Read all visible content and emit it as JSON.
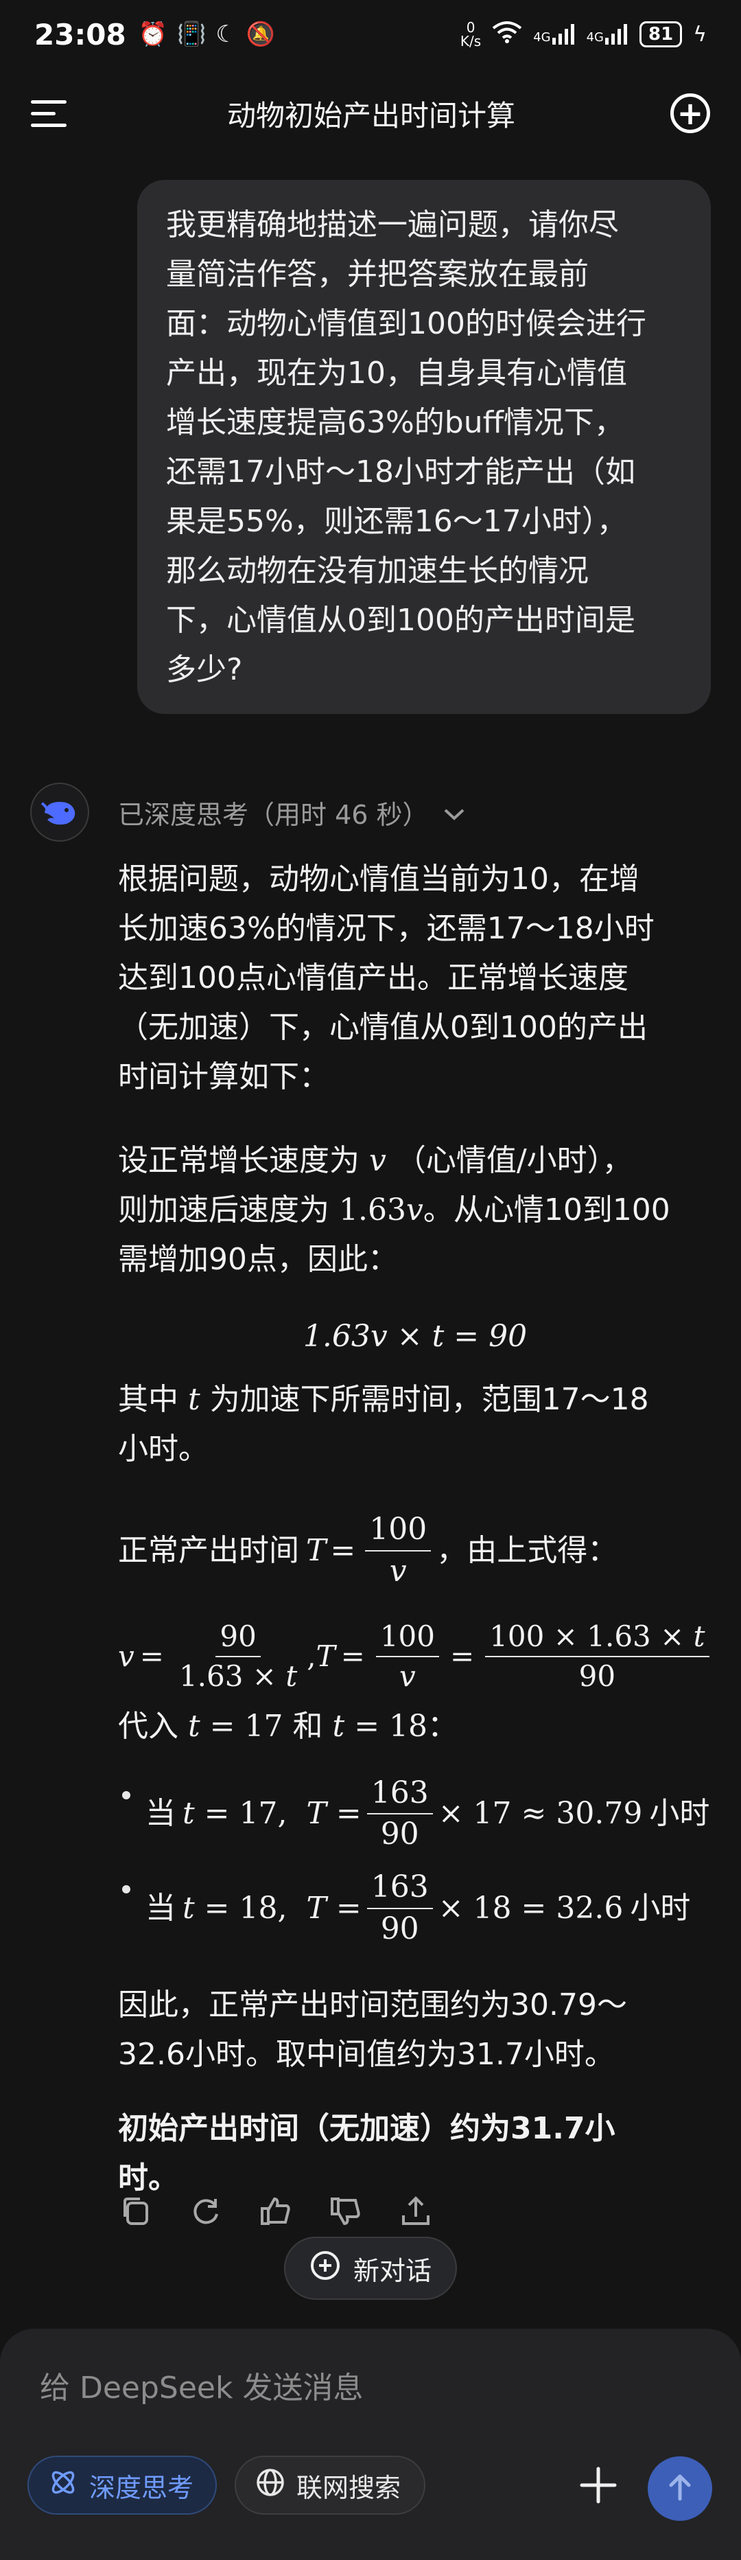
{
  "status_bar": {
    "time": "23:08",
    "net_speed_value": "0",
    "net_speed_unit": "K/s",
    "network_1": "4G",
    "network_2": "4G",
    "battery": "81"
  },
  "header": {
    "title": "动物初始产出时间计算"
  },
  "user_message": {
    "lines": [
      "我更精确地描述一遍问题，请你尽",
      "量简洁作答，并把答案放在最前",
      "面：动物心情值到100的时候会进行",
      "产出，现在为10，自身具有心情值",
      "增长速度提高63%的buff情况下，",
      "还需17小时～18小时才能产出（如",
      "果是55%，则还需16～17小时），",
      "那么动物在没有加速生长的情况",
      "下，心情值从0到100的产出时间是",
      "多少?"
    ]
  },
  "assistant": {
    "think_status": "已深度思考（用时 46 秒）",
    "intro_lines": [
      "根据问题，动物心情值当前为10，在增",
      "长加速63%的情况下，还需17～18小时",
      "达到100点心情值产出。正常增长速度",
      "（无加速）下，心情值从0到100的产出",
      "时间计算如下："
    ],
    "p2_a": "设正常增长速度为",
    "p2_b": "（心情值/小时），",
    "p2_c": "则加速后速度为",
    "p2_d": "。从心情10到100",
    "p2_e": "需增加90点，因此：",
    "eq1": "1.63v × t = 90",
    "p3_a": "其中",
    "p3_b": "为加速下所需时间，范围17～18",
    "p3_c": "小时。",
    "p4_a": "正常产出时间",
    "p4_b": "，由上式得：",
    "p5_a": "代入",
    "p5_b": "和",
    "bullet_prefix": "当",
    "bullet1_result": "≈ 30.79",
    "bullet2_result": "= 32.6",
    "unit_hours": "小时",
    "conclusion_lines": [
      "因此，正常产出时间范围约为30.79～",
      "32.6小时。取中间值约为31.7小时。"
    ],
    "final_lines": [
      "初始产出时间（无加速）约为31.7小",
      "时。"
    ]
  },
  "new_chat_label": "新对话",
  "composer": {
    "placeholder": "给 DeepSeek 发送消息",
    "deep_think_label": "深度思考",
    "web_search_label": "联网搜索"
  },
  "colors": {
    "background": "#141414",
    "user_bubble": "#2c2c2e",
    "accent_blue": "#6f9bff",
    "send_button": "#3d5fb8"
  }
}
